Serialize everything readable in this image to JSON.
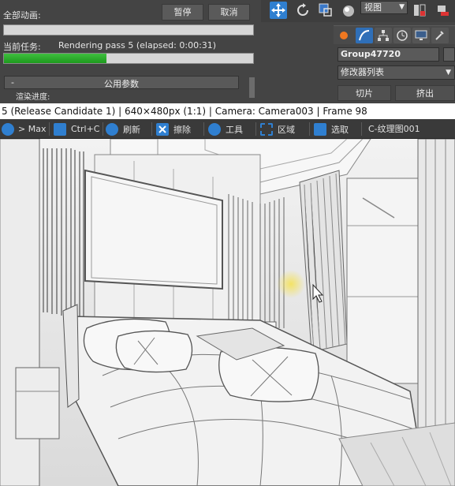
{
  "dialog": {
    "overall_label": "全部动画:",
    "pause_label": "暂停",
    "cancel_label": "取消",
    "current_task_label": "当前任务:",
    "current_task_value": "Rendering pass 5 (elapsed: 0:00:31)",
    "overall_progress": 0.0,
    "task_progress": 0.41,
    "rollout_minus": "-",
    "rollout_title": "公用参数",
    "render_progress_label": "渲染进度:"
  },
  "max_ui": {
    "view_select": "视图",
    "group_name": "Group47720",
    "modifier_list": "修改器列表",
    "sub_tabs": [
      "切片",
      "挤出"
    ]
  },
  "frame": {
    "title": "5 (Release Candidate 1) | 640×480px (1:1) | Camera: Camera003 | Frame 98",
    "toolbar": {
      "max_link": "> Max",
      "copy": "Ctrl+C",
      "refresh": "刷新",
      "erase": "擦除",
      "tools": "工具",
      "region": "区域",
      "pick": "选取",
      "texture": "C-纹理图001"
    }
  },
  "colors": {
    "accent_blue": "#2f7fd0",
    "progress_green": "#2aa82a",
    "highlight_yellow": "#f0dc50"
  }
}
